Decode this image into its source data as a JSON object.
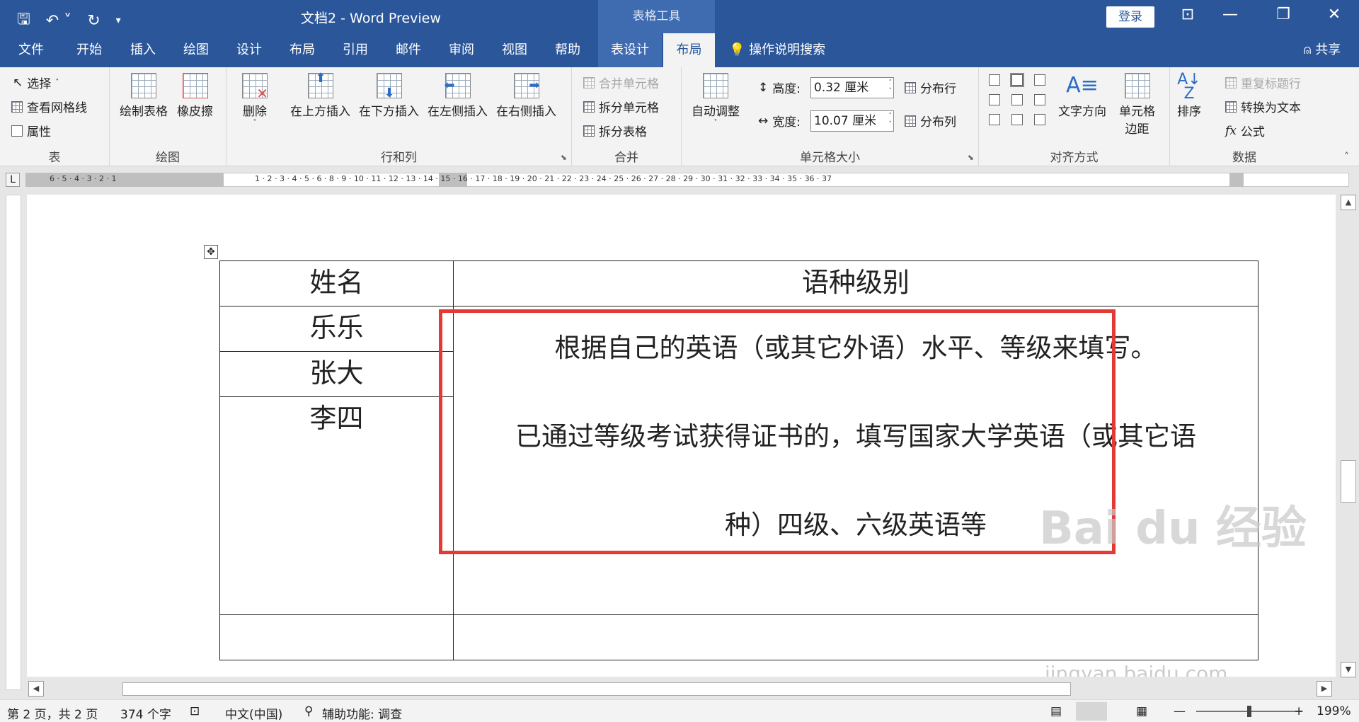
{
  "titlebar": {
    "title": "文档2  -  Word Preview",
    "context_tools": "表格工具",
    "login_label": "登录"
  },
  "tabs": [
    "文件",
    "开始",
    "插入",
    "绘图",
    "设计",
    "布局",
    "引用",
    "邮件",
    "审阅",
    "视图",
    "帮助",
    "表设计",
    "布局"
  ],
  "search_label": "操作说明搜索",
  "share_label": "共享",
  "ribbon": {
    "table": {
      "label": "表",
      "select": "选择",
      "gridlines": "查看网格线",
      "properties": "属性"
    },
    "draw": {
      "label": "绘图",
      "draw_table": "绘制表格",
      "eraser": "橡皮擦"
    },
    "rows_cols": {
      "label": "行和列",
      "delete": "删除",
      "insert_above": "在上方插入",
      "insert_below": "在下方插入",
      "insert_left": "在左侧插入",
      "insert_right": "在右侧插入"
    },
    "merge": {
      "label": "合并",
      "merge_cells": "合并单元格",
      "split_cells": "拆分单元格",
      "split_table": "拆分表格"
    },
    "cell_size": {
      "label": "单元格大小",
      "autofit": "自动调整",
      "height_label": "高度:",
      "height_value": "0.32 厘米",
      "width_label": "宽度:",
      "width_value": "10.07 厘米",
      "distribute_rows": "分布行",
      "distribute_cols": "分布列"
    },
    "alignment": {
      "label": "对齐方式",
      "text_direction": "文字方向",
      "cell_margins_1": "单元格",
      "cell_margins_2": "边距"
    },
    "data": {
      "label": "数据",
      "sort": "排序",
      "repeat_header": "重复标题行",
      "convert_text": "转换为文本",
      "formula": "公式"
    }
  },
  "ruler": {
    "ticks_left": "6 · 5 · 4 · 3 · 2 · 1",
    "ticks_right": "1 · 2 · 3 · 4 · 5 · 6 · 8 · 9 · 10 · 11 · 12 · 13 · 14 · 15 · 16 · 17 · 18 · 19 · 20 · 21 · 22 · 23 · 24 · 25 · 26 · 27 · 28 · 29 · 30 · 31 · 32 · 33 · 34 · 35 · 36 · 37"
  },
  "table": {
    "header": [
      "姓名",
      "语种级别"
    ],
    "names": [
      "乐乐",
      "张大",
      "李四"
    ],
    "level_text": [
      "根据自己的英语（或其它外语）水平、等级来填写。",
      "已通过等级考试获得证书的，填写国家大学英语（或其它语",
      "种）四级、六级英语等"
    ]
  },
  "status": {
    "page": "第 2 页，共 2 页",
    "words": "374 个字",
    "language": "中文(中国)",
    "accessibility": "辅助功能: 调查",
    "zoom": "199%"
  },
  "watermark": {
    "brand": "Bai du 经验",
    "url": "jingyan.baidu.com"
  },
  "colors": {
    "accent": "#2b579a",
    "highlight": "#e53935"
  }
}
